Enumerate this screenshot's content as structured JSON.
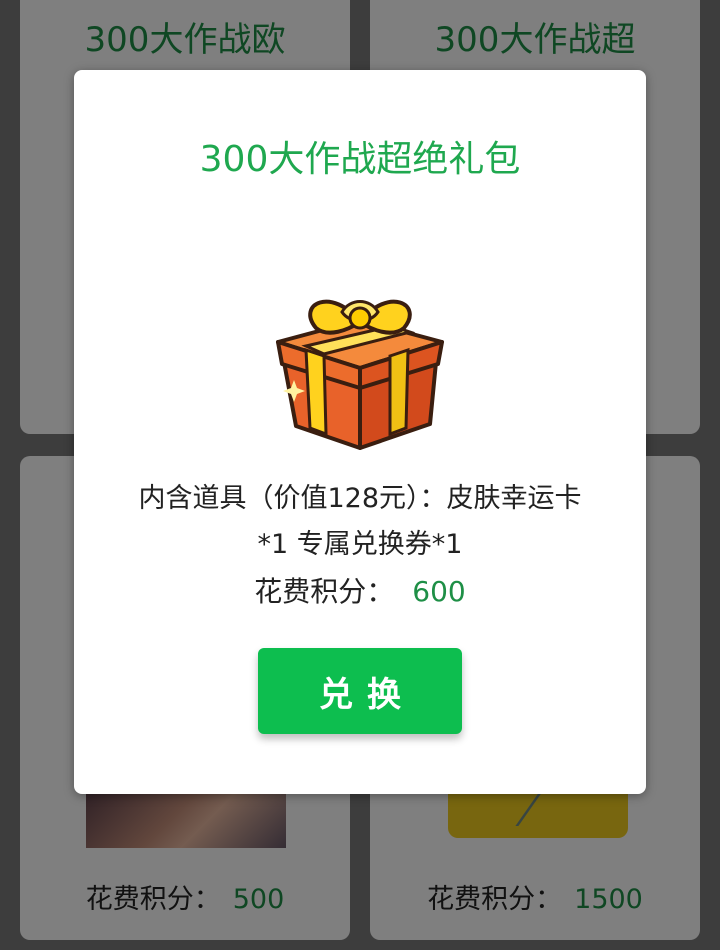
{
  "background": {
    "cards": [
      {
        "title": "300大作战欧",
        "cost_label": "",
        "cost_value": ""
      },
      {
        "title": "300大作战超",
        "cost_label": "",
        "cost_value": ""
      },
      {
        "title": "",
        "cost_label": "花费积分：",
        "cost_value": "500"
      },
      {
        "title": "",
        "cost_label": "花费积分：",
        "cost_value": "1500"
      }
    ]
  },
  "modal": {
    "title": "300大作战超绝礼包",
    "gift_icon": "gift-box-icon",
    "description_line1": "内含道具（价值128元）：皮肤幸运卡",
    "description_line2": "*1 专属兑换券*1",
    "cost_label": "花费积分：",
    "cost_value": "600",
    "redeem_label": "兑换"
  },
  "colors": {
    "accent_green": "#0dbe4f",
    "title_green": "#1fa84f",
    "value_green": "#1e8f46"
  }
}
